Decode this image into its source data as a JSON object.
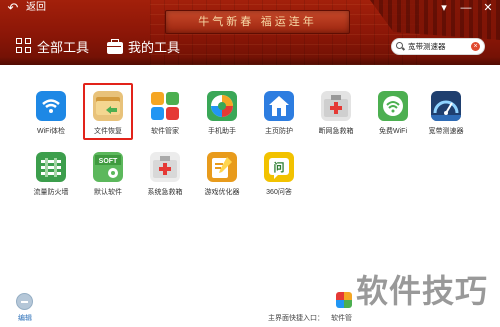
{
  "titlebar": {
    "back_label": "返回",
    "back_glyph": "↶",
    "controls": [
      "▾",
      "—",
      "✕"
    ]
  },
  "banner": {
    "text": "牛气新春 福运连年"
  },
  "tabs": [
    {
      "label": "全部工具",
      "icon": "grid-icon"
    },
    {
      "label": "我的工具",
      "icon": "briefcase-icon"
    }
  ],
  "search": {
    "value": "宽带测速器",
    "clear_glyph": "×"
  },
  "tools": [
    {
      "label": "WiFi体检",
      "icon": "wifi-check-icon",
      "color": "#1e88e5"
    },
    {
      "label": "文件恢复",
      "icon": "file-recovery-icon",
      "color": "#d8a24a",
      "selected": true
    },
    {
      "label": "软件管家",
      "icon": "software-manager-icon",
      "color": "#f0a020"
    },
    {
      "label": "手机助手",
      "icon": "phone-assistant-icon",
      "color": "#3aa757"
    },
    {
      "label": "主页防护",
      "icon": "homepage-protect-icon",
      "color": "#2d7de0"
    },
    {
      "label": "断网急救箱",
      "icon": "network-rescue-icon",
      "color": "#c7c7c7"
    },
    {
      "label": "免费WiFi",
      "icon": "free-wifi-icon",
      "color": "#4caf50"
    },
    {
      "label": "宽带测速器",
      "icon": "speed-test-icon",
      "color": "#1f3f6f"
    },
    {
      "label": "流量防火墙",
      "icon": "firewall-icon",
      "color": "#3c9e4c"
    },
    {
      "label": "默认软件",
      "icon": "default-software-icon",
      "color": "#5cb85c"
    },
    {
      "label": "系统急救箱",
      "icon": "system-rescue-icon",
      "color": "#d8d8d8"
    },
    {
      "label": "游戏优化器",
      "icon": "game-optimizer-icon",
      "color": "#e89b1c"
    },
    {
      "label": "360问答",
      "icon": "qa-icon",
      "color": "#f2c200"
    }
  ],
  "footer": {
    "edit_label": "编辑",
    "shortcut_label": "主界面快捷入口：",
    "shortcut_app_label": "软件管"
  },
  "watermark": "软件技巧"
}
